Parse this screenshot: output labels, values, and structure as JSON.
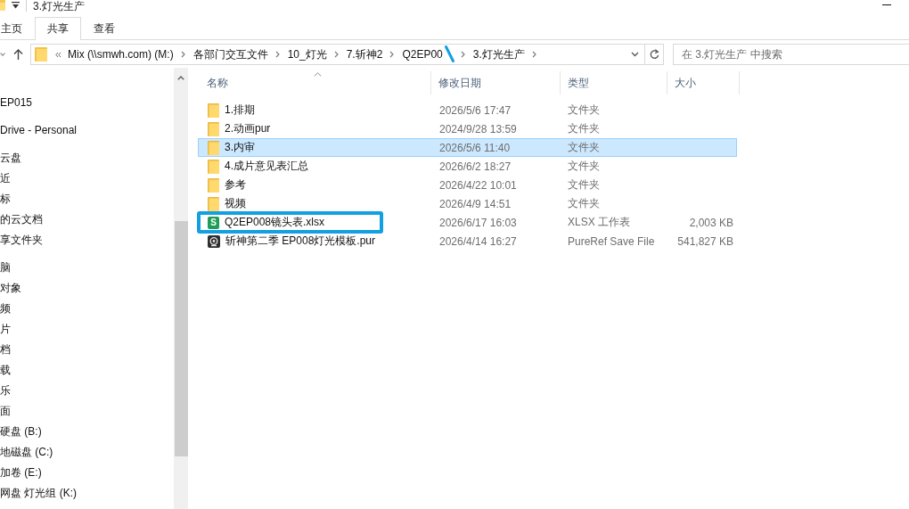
{
  "window": {
    "title": "3.灯光生产"
  },
  "ribbon": {
    "tabs": [
      {
        "label": "主页",
        "selected": false
      },
      {
        "label": "共享",
        "selected": true
      },
      {
        "label": "查看",
        "selected": false
      }
    ]
  },
  "address_bar": {
    "crumbs": [
      {
        "label": "Mix (\\\\smwh.com) (M:)",
        "annotated": false
      },
      {
        "label": "各部门交互文件",
        "annotated": false
      },
      {
        "label": "10_灯光",
        "annotated": false
      },
      {
        "label": "7.斩神2",
        "annotated": false
      },
      {
        "label": "Q2EP00",
        "annotated": true
      },
      {
        "label": "3.灯光生产",
        "annotated": false
      }
    ]
  },
  "search": {
    "placeholder": "在 3.灯光生产 中搜索"
  },
  "sidebar": {
    "sections": [
      {
        "items": [
          "EP015"
        ]
      },
      {
        "items": [
          "Drive - Personal"
        ]
      },
      {
        "items": [
          "云盘",
          "近",
          "标",
          "的云文档",
          "享文件夹"
        ]
      },
      {
        "items": [
          "脑",
          "对象",
          "频",
          "片",
          "档",
          "载",
          "乐",
          "面",
          "硬盘 (B:)",
          "地磁盘 (C:)",
          "加卷 (E:)",
          "网盘 灯光组 (K:)"
        ]
      }
    ]
  },
  "file_list": {
    "columns": [
      {
        "label": "名称",
        "sorted": true
      },
      {
        "label": "修改日期",
        "sorted": false
      },
      {
        "label": "类型",
        "sorted": false
      },
      {
        "label": "大小",
        "sorted": false
      }
    ],
    "rows": [
      {
        "kind": "folder",
        "name": "1.排期",
        "modified": "2026/5/6 17:47",
        "type": "文件夹",
        "selected": false,
        "annotated": false
      },
      {
        "kind": "folder",
        "name": "2.动画pur",
        "modified": "2024/9/28 13:59",
        "type": "文件夹",
        "selected": false,
        "annotated": false
      },
      {
        "kind": "folder",
        "name": "3.内审",
        "modified": "2026/5/6 11:40",
        "type": "文件夹",
        "selected": true,
        "annotated": false
      },
      {
        "kind": "folder",
        "name": "4.成片意见表汇总",
        "modified": "2026/6/2 18:27",
        "type": "文件夹",
        "selected": false,
        "annotated": false
      },
      {
        "kind": "folder",
        "name": "参考",
        "modified": "2026/4/22 10:01",
        "type": "文件夹",
        "selected": false,
        "annotated": false
      },
      {
        "kind": "folder",
        "name": "视频",
        "modified": "2026/4/9 14:51",
        "type": "文件夹",
        "selected": false,
        "annotated": false
      },
      {
        "kind": "spreadsheet",
        "icon_letter": "S",
        "name": "Q2EP008镜头表.xlsx",
        "modified": "2026/6/17 16:03",
        "type": "XLSX 工作表",
        "size": "2,003 KB",
        "selected": false,
        "annotated": true
      },
      {
        "kind": "pureref",
        "name": "斩神第二季 EP008灯光模板.pur",
        "modified": "2026/4/14 16:27",
        "type": "PureRef Save File",
        "size": "541,827 KB",
        "selected": false,
        "annotated": false
      }
    ]
  }
}
